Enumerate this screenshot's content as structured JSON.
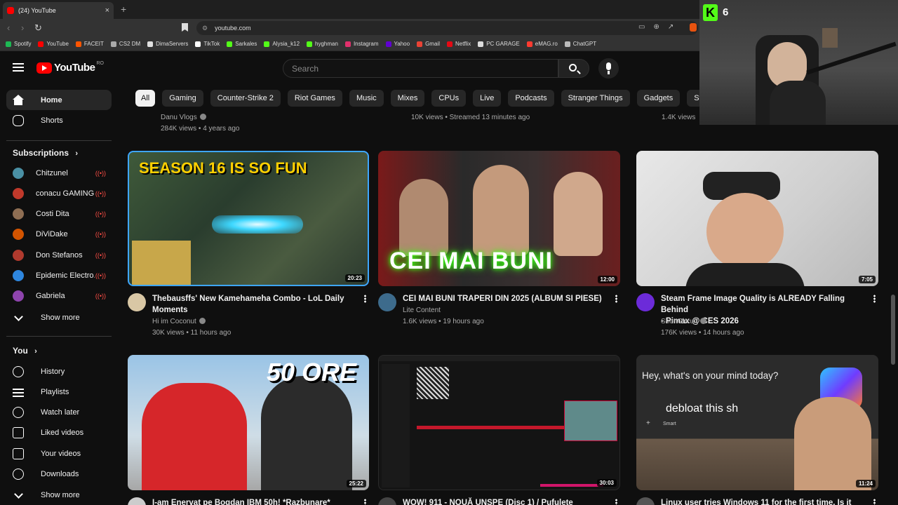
{
  "browser": {
    "tab_title": "(24) YouTube",
    "tab_close": "×",
    "new_tab": "+",
    "url": "youtube.com",
    "bookmarks": [
      {
        "label": "Spotify",
        "color": "#1db954"
      },
      {
        "label": "YouTube",
        "color": "#ff0000"
      },
      {
        "label": "FACEIT",
        "color": "#ff5500"
      },
      {
        "label": "CS2 DM",
        "color": "#aaaaaa"
      },
      {
        "label": "DimaServers",
        "color": "#e0e0e0"
      },
      {
        "label": "TikTok",
        "color": "#ffffff"
      },
      {
        "label": "Sarkales",
        "color": "#53fc18"
      },
      {
        "label": "Alysia_k12",
        "color": "#53fc18"
      },
      {
        "label": "hyghman",
        "color": "#53fc18"
      },
      {
        "label": "Instagram",
        "color": "#e1306c"
      },
      {
        "label": "Yahoo",
        "color": "#6001d2"
      },
      {
        "label": "Gmail",
        "color": "#ea4335"
      },
      {
        "label": "Netflix",
        "color": "#e50914"
      },
      {
        "label": "PC GARAGE",
        "color": "#dddddd"
      },
      {
        "label": "eMAG.ro",
        "color": "#ff3b30"
      },
      {
        "label": "ChatGPT",
        "color": "#bbbbbb"
      }
    ]
  },
  "masthead": {
    "logo_text": "YouTube",
    "country": "RO",
    "search_placeholder": "Search"
  },
  "chips": [
    "All",
    "Gaming",
    "Counter-Strike 2",
    "Riot Games",
    "Music",
    "Mixes",
    "CPUs",
    "Live",
    "Podcasts",
    "Stranger Things",
    "Gadgets",
    "Steering wheels"
  ],
  "sidebar": {
    "main": [
      {
        "label": "Home",
        "icon": "home-icon"
      },
      {
        "label": "Shorts",
        "icon": "shorts-icon"
      }
    ],
    "subscriptions_heading": "Subscriptions",
    "subscriptions": [
      {
        "label": "Chitzunel",
        "color": "#4a90a4"
      },
      {
        "label": "conacu GAMING",
        "color": "#c0392b"
      },
      {
        "label": "Costi Dita",
        "color": "#8e6e53"
      },
      {
        "label": "DiViDake",
        "color": "#d35400"
      },
      {
        "label": "Don Stefanos",
        "color": "#b03a2e"
      },
      {
        "label": "Epidemic Electro...",
        "color": "#2e86de"
      },
      {
        "label": "Gabriela",
        "color": "#8e44ad"
      }
    ],
    "show_more": "Show more",
    "you_heading": "You",
    "you_items": [
      {
        "label": "History",
        "icon": "history-icon"
      },
      {
        "label": "Playlists",
        "icon": "playlists-icon"
      },
      {
        "label": "Watch later",
        "icon": "watch-later-icon"
      },
      {
        "label": "Liked videos",
        "icon": "like-icon"
      },
      {
        "label": "Your videos",
        "icon": "your-videos-icon"
      },
      {
        "label": "Downloads",
        "icon": "download-icon"
      }
    ],
    "show_more_2": "Show more"
  },
  "previous_row": [
    {
      "channel": "Danu Vlogs",
      "stats": "284K views • 4 years ago"
    },
    {
      "channel": "",
      "stats": "10K views • Streamed 13 minutes ago"
    },
    {
      "channel": "",
      "stats": "1.4K views"
    }
  ],
  "videos": [
    {
      "title_line1": "Thebausffs' New Kamehameha Combo - LoL Daily",
      "title_line2": "Moments",
      "channel": "Hi im Coconut",
      "stats": "30K views • 11 hours ago",
      "duration": "20:23",
      "thumb_text": "SEASON 16 IS SO FUN",
      "avatar_color": "#d9c7a5"
    },
    {
      "title_line1": "CEI MAI BUNI TRAPERI DIN 2025 (ALBUM SI PIESE)",
      "title_line2": "",
      "channel": "Lite Content",
      "stats": "1.6K views • 19 hours ago",
      "duration": "12:00",
      "thumb_text": "CEI MAI BUNI",
      "avatar_color": "#3d6b8c"
    },
    {
      "title_line1": "Steam Frame Image Quality is ALREADY Falling Behind",
      "title_line2": "- Pimax @ CES 2026",
      "channel": "ShortCircuit",
      "stats": "176K views • 14 hours ago",
      "duration": "7:05",
      "thumb_text": "",
      "avatar_color": "#6c2bd9"
    },
    {
      "title_line1": "I-am Enervat pe Bogdan IBM 50h! *Razbunare*",
      "title_line2": "",
      "channel": "",
      "stats": "",
      "duration": "25:22",
      "thumb_text": "50 ORE",
      "avatar_color": "#cccccc"
    },
    {
      "title_line1": "WOW! 911 - NOUĂ UNSPE (Disc 1) / Pufulete",
      "title_line2": "",
      "channel": "",
      "stats": "",
      "duration": "30:03",
      "thumb_text": "",
      "avatar_color": "#444444"
    },
    {
      "title_line1": "Linux user tries Windows 11 for the first time. Is it",
      "title_line2": "",
      "channel": "",
      "stats": "",
      "duration": "11:24",
      "thumb_text": "Hey, what's on your mind today?",
      "thumb_text2": "debloat this sh",
      "thumb_text3": "Smart",
      "avatar_color": "#555555"
    }
  ],
  "overlay": {
    "kick_letter": "K",
    "viewer_count": "6"
  }
}
